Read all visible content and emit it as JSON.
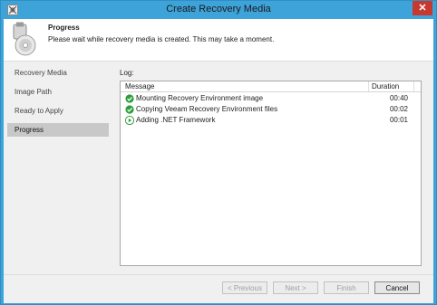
{
  "window": {
    "title": "Create Recovery Media"
  },
  "header": {
    "title": "Progress",
    "subtitle": "Please wait while recovery media is created. This may take a moment."
  },
  "sidebar": {
    "items": [
      {
        "label": "Recovery Media",
        "active": false
      },
      {
        "label": "Image Path",
        "active": false
      },
      {
        "label": "Ready to Apply",
        "active": false
      },
      {
        "label": "Progress",
        "active": true
      }
    ]
  },
  "log": {
    "label": "Log:",
    "columns": {
      "message": "Message",
      "duration": "Duration"
    },
    "rows": [
      {
        "message": "Mounting Recovery Environment image",
        "duration": "00:40",
        "status": "success-icon"
      },
      {
        "message": "Copying Veeam Recovery Environment files",
        "duration": "00:02",
        "status": "success-icon"
      },
      {
        "message": "Adding .NET Framework",
        "duration": "00:01",
        "status": "in-progress-icon"
      }
    ]
  },
  "buttons": {
    "previous": "< Previous",
    "next": "Next >",
    "finish": "Finish",
    "cancel": "Cancel"
  },
  "colors": {
    "titlebar": "#3da3d8",
    "close": "#c7382f",
    "success": "#2e9e3a"
  }
}
